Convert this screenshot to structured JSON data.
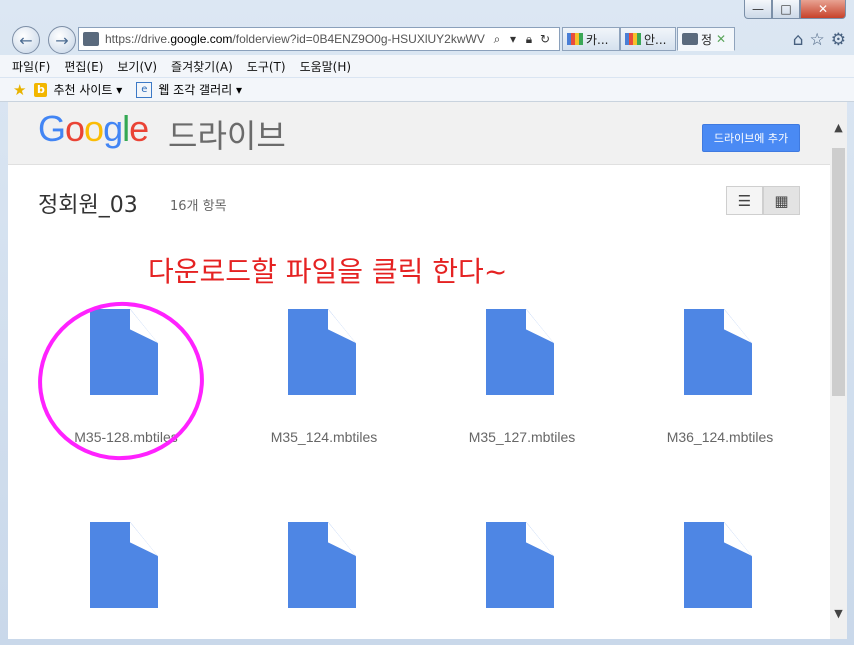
{
  "window": {
    "minimize": "—",
    "maximize": "□",
    "close": "✕"
  },
  "nav": {
    "back_icon": "←",
    "forward_icon": "→",
    "url_prefix": "https://drive.",
    "url_domain": "google.com",
    "url_rest": "/folderview?id=0B4ENZ9O0g-HSUXlUY2kwWV",
    "tabs": [
      {
        "label": "카...",
        "color": "#5b8ed8"
      },
      {
        "label": "안...",
        "color": "#5b8ed8"
      },
      {
        "label": "정",
        "close": "✕"
      }
    ]
  },
  "menu": {
    "items": [
      "파일(F)",
      "편집(E)",
      "보기(V)",
      "즐겨찾기(A)",
      "도구(T)",
      "도움말(H)"
    ]
  },
  "favorites": {
    "bing_label": "추천 사이트 ▾",
    "gallery_label": "웹 조각 갤러리 ▾"
  },
  "drive": {
    "logo_letters": [
      {
        "ch": "G",
        "color": "#4285f4"
      },
      {
        "ch": "o",
        "color": "#ea4335"
      },
      {
        "ch": "o",
        "color": "#fbbc05"
      },
      {
        "ch": "g",
        "color": "#4285f4"
      },
      {
        "ch": "l",
        "color": "#34a853"
      },
      {
        "ch": "e",
        "color": "#ea4335"
      }
    ],
    "product_name": "드라이브",
    "add_button": "드라이브에 추가",
    "folder_title": "정회원_03",
    "item_count": "16개 항목",
    "annotation": "다운로드할 파일을 클릭 한다~",
    "files": [
      {
        "name": "M35-128.mbtiles"
      },
      {
        "name": "M35_124.mbtiles"
      },
      {
        "name": "M35_127.mbtiles"
      },
      {
        "name": "M36_124.mbtiles"
      },
      {
        "name": ""
      },
      {
        "name": ""
      },
      {
        "name": ""
      },
      {
        "name": ""
      }
    ]
  },
  "scroll": {
    "up": "▲",
    "down": "▼"
  }
}
